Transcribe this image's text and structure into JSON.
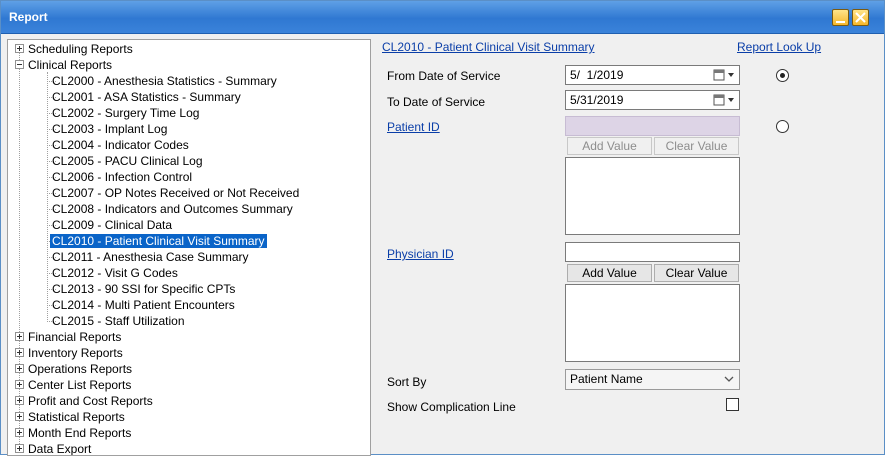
{
  "window": {
    "title": "Report"
  },
  "tree": {
    "groups": [
      {
        "label": "Scheduling Reports"
      },
      {
        "label": "Clinical Reports"
      },
      {
        "label": "Financial Reports"
      },
      {
        "label": "Inventory Reports"
      },
      {
        "label": "Operations Reports"
      },
      {
        "label": "Center List Reports"
      },
      {
        "label": "Profit and Cost Reports"
      },
      {
        "label": "Statistical Reports"
      },
      {
        "label": "Month End Reports"
      },
      {
        "label": "Data Export"
      }
    ],
    "clinical_children": [
      {
        "label": "CL2000 - Anesthesia Statistics - Summary"
      },
      {
        "label": "CL2001 - ASA Statistics - Summary"
      },
      {
        "label": "CL2002 - Surgery Time Log"
      },
      {
        "label": "CL2003 - Implant Log"
      },
      {
        "label": "CL2004 - Indicator Codes"
      },
      {
        "label": "CL2005 - PACU Clinical Log"
      },
      {
        "label": "CL2006 - Infection Control"
      },
      {
        "label": "CL2007 - OP Notes Received or Not Received"
      },
      {
        "label": "CL2008 - Indicators and Outcomes Summary"
      },
      {
        "label": "CL2009 - Clinical Data"
      },
      {
        "label": "CL2010 - Patient Clinical Visit Summary",
        "selected": true
      },
      {
        "label": "CL2011 - Anesthesia Case Summary"
      },
      {
        "label": "CL2012 - Visit G Codes"
      },
      {
        "label": "CL2013 - 90 SSI for Specific CPTs"
      },
      {
        "label": "CL2014 - Multi Patient Encounters"
      },
      {
        "label": "CL2015 - Staff Utilization"
      }
    ]
  },
  "panel": {
    "report_title": "CL2010 - Patient Clinical Visit Summary",
    "lookup_link": "Report Look Up",
    "from_date": {
      "label": "From Date of Service",
      "value": "5/  1/2019",
      "radio_selected": true
    },
    "to_date": {
      "label": "To Date of Service",
      "value": "5/31/2019"
    },
    "patient": {
      "label": "Patient ID",
      "value": "",
      "add_label": "Add Value",
      "clear_label": "Clear Value",
      "radio_selected": false
    },
    "physician": {
      "label": "Physician ID",
      "value": "",
      "add_label": "Add Value",
      "clear_label": "Clear Value"
    },
    "sort_by": {
      "label": "Sort By",
      "value": "Patient Name"
    },
    "complication": {
      "label": "Show Complication Line",
      "checked": false
    }
  }
}
